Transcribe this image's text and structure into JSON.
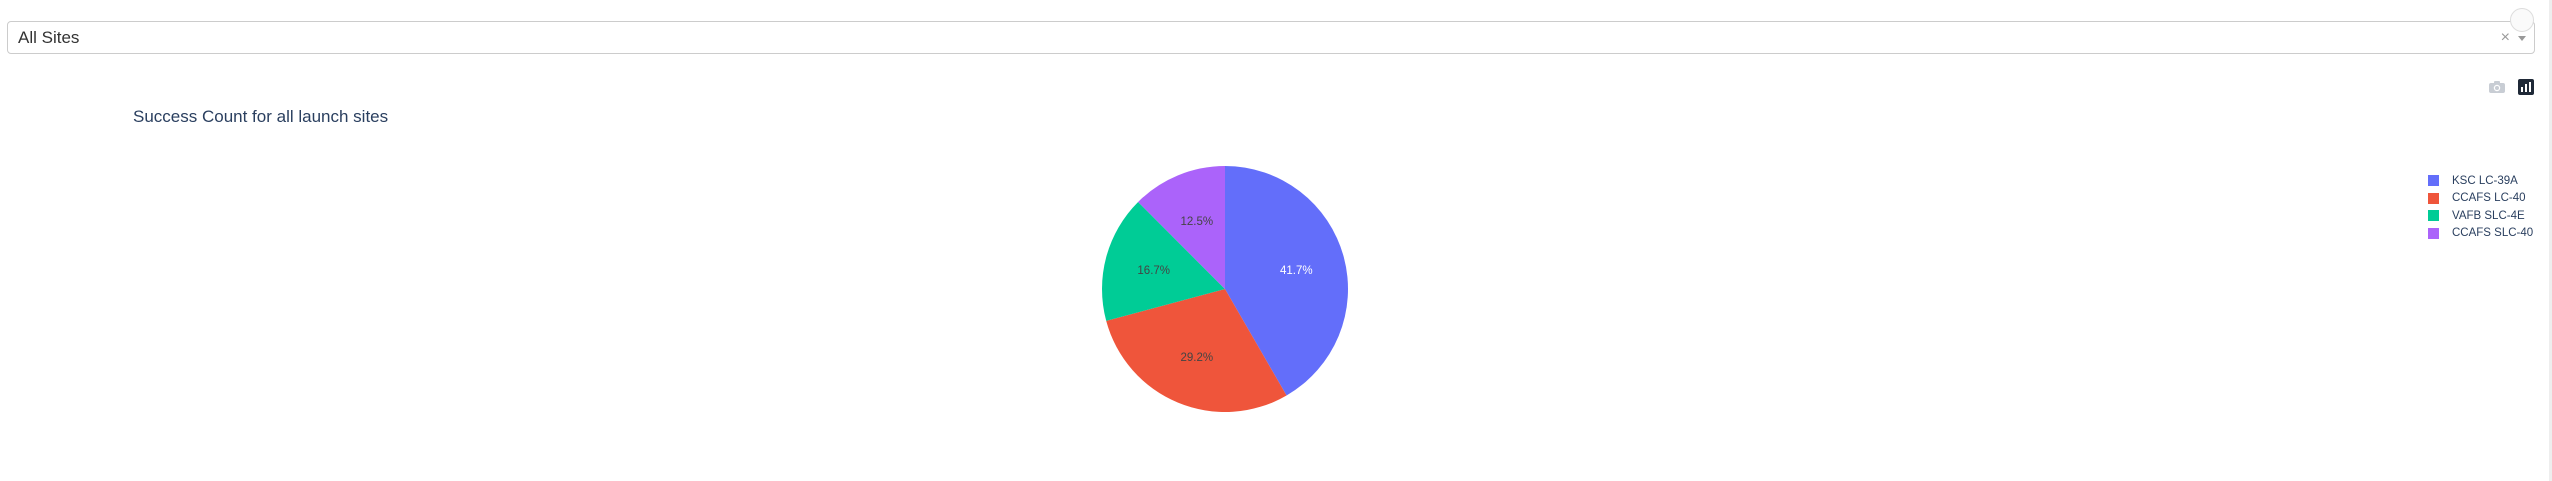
{
  "dropdown": {
    "value": "All Sites",
    "clear_icon": "clear-icon",
    "arrow_icon": "chevron-down-icon"
  },
  "modebar": {
    "buttons": [
      "camera-icon",
      "plotly-logo-icon"
    ]
  },
  "chart_data": {
    "type": "pie",
    "title": "Success Count for all launch sites",
    "labels": [
      "KSC LC-39A",
      "CCAFS LC-40",
      "VAFB SLC-4E",
      "CCAFS SLC-40"
    ],
    "values": [
      41.7,
      29.2,
      16.7,
      12.5
    ],
    "text_labels": [
      "41.7%",
      "29.2%",
      "16.7%",
      "12.5%"
    ],
    "colors": [
      "#636efa",
      "#ef553b",
      "#00cc96",
      "#ab63fa"
    ],
    "label_colors": [
      "#ffffff",
      "#444444",
      "#444444",
      "#444444"
    ],
    "legend_position": "top-right"
  }
}
